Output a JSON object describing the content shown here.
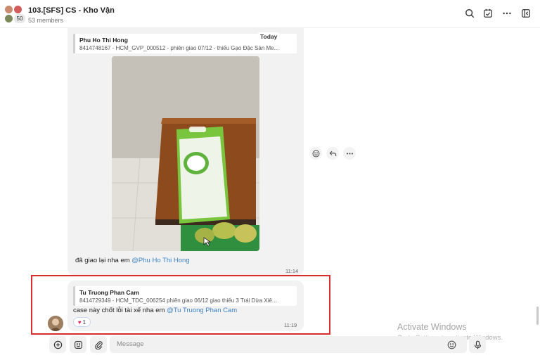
{
  "header": {
    "title": "103.[SFS] CS - Kho Vận",
    "members": "53 members",
    "avatar_count": "50",
    "icons": [
      "search-icon",
      "task-check-icon",
      "more-icon",
      "sidebar-toggle-icon"
    ]
  },
  "message1": {
    "reply": {
      "name": "Phu Ho Thi Hong",
      "text": "8414748167 - HCM_GVP_000512 - phiên giao 07/12 - thiếu Gạo Đặc Sản Me..."
    },
    "date_badge": "Today",
    "text": "đã giao lại nha em ",
    "mention": "@Phu Ho Thi Hong",
    "time": "11:14",
    "actions": [
      "emoji-react-icon",
      "reply-icon",
      "more-icon"
    ]
  },
  "message2": {
    "reply": {
      "name": "Tu Truong Phan Cam",
      "text": "8414729349 - HCM_TDC_006254 phiên giao 06/12 giao thiếu 3 Trái Dừa Xiê..."
    },
    "text": "case này chốt lỗi tài xế nha em ",
    "mention": "@Tu Truong Phan Cam",
    "time": "11:19",
    "reaction_count": "1"
  },
  "watermark": {
    "title": "Activate Windows",
    "subtitle": "Go to Settings to activate Windows."
  },
  "composer": {
    "placeholder": "Message",
    "buttons": [
      "add-icon",
      "sticker-icon",
      "attach-icon"
    ]
  },
  "colors": {
    "mention": "#3b82c4",
    "highlight_box": "#d92d2d",
    "bubble": "#f2f2f2"
  }
}
